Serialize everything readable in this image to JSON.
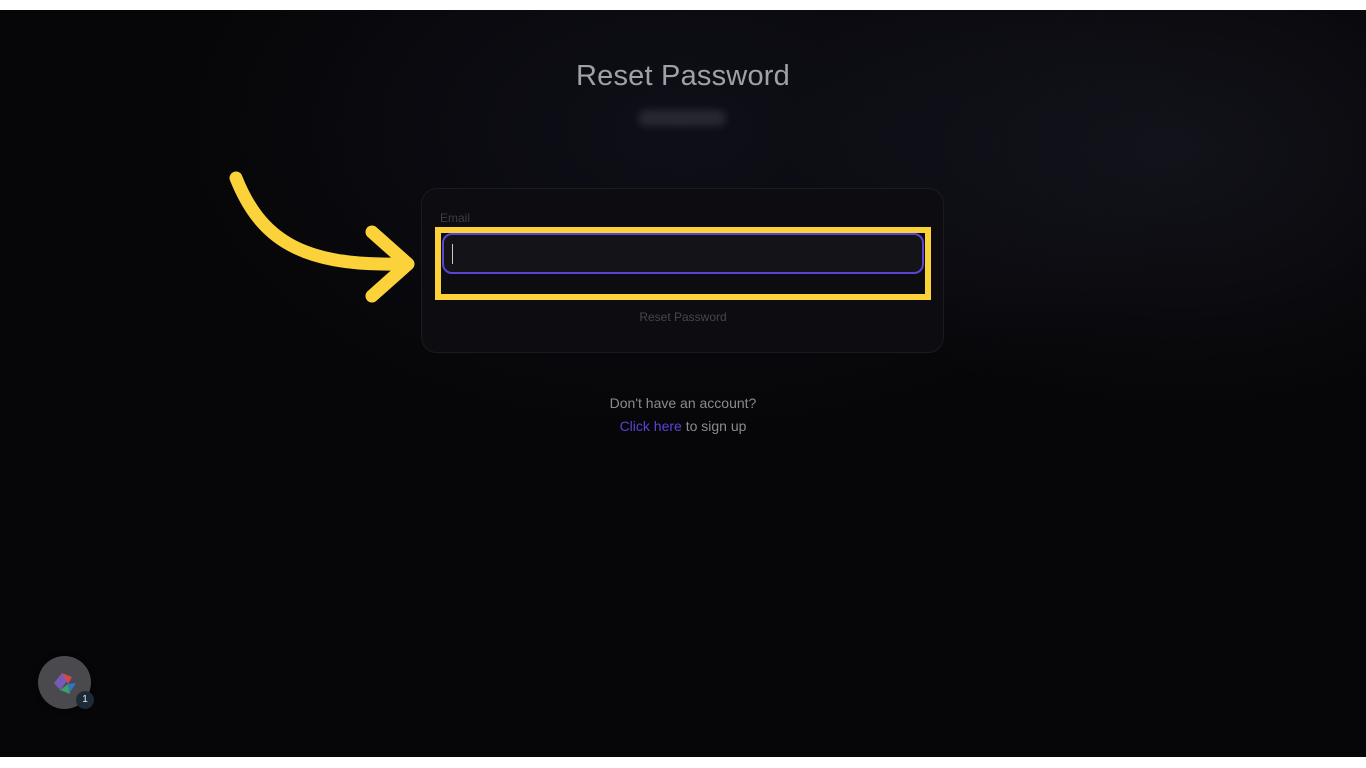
{
  "page": {
    "title": "Reset Password"
  },
  "form": {
    "email_label": "Email",
    "email_value": "",
    "email_placeholder": "",
    "submit_label": "Reset Password"
  },
  "signup": {
    "prompt": "Don't have an account?",
    "link_text": "Click here",
    "suffix": " to sign up"
  },
  "annotation": {
    "arrow_icon": "curved-arrow-icon",
    "highlight_color": "#fcd23a"
  },
  "badge": {
    "icon": "app-logo-icon",
    "count": "1"
  },
  "colors": {
    "background": "#060608",
    "accent": "#5b43d6",
    "title": "#a0a0a6"
  }
}
